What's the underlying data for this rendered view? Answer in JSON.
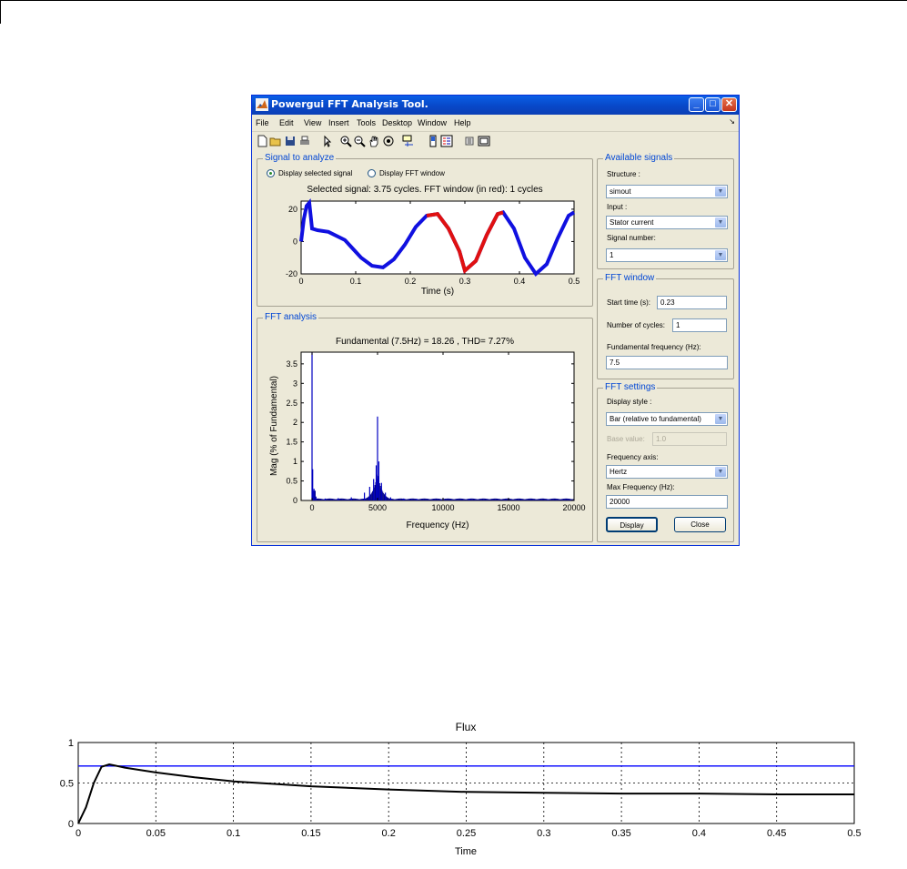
{
  "window": {
    "title": "Powergui FFT Analysis Tool.",
    "minimize_glyph": "_",
    "maximize_glyph": "□",
    "close_glyph": "✕"
  },
  "menu": [
    "File",
    "Edit",
    "View",
    "Insert",
    "Tools",
    "Desktop",
    "Window",
    "Help"
  ],
  "toolbar_icons": [
    "new-file-icon",
    "open-folder-icon",
    "save-icon",
    "print-icon",
    "pointer-icon",
    "zoom-in-icon",
    "zoom-out-icon",
    "pan-hand-icon",
    "rotate-icon",
    "data-cursor-icon",
    "colorbar-icon",
    "legend-icon",
    "hide-plot-tools-icon",
    "show-plot-tools-icon"
  ],
  "signal_panel": {
    "title": "Signal to analyze",
    "radio_selected": "Display selected signal",
    "radio_fft": "Display FFT window",
    "plot_title": "Selected signal: 3.75 cycles. FFT window (in red): 1 cycles",
    "xlabel": "Time (s)",
    "xticks": [
      "0",
      "0.1",
      "0.2",
      "0.3",
      "0.4",
      "0.5"
    ],
    "yticks": [
      "20",
      "0",
      "-20"
    ]
  },
  "fft_panel": {
    "title": "FFT analysis",
    "plot_title": "Fundamental (7.5Hz) = 18.26 , THD= 7.27%",
    "ylabel": "Mag (% of Fundamental)",
    "xlabel": "Frequency (Hz)",
    "xticks": [
      "0",
      "5000",
      "10000",
      "15000",
      "20000"
    ],
    "yticks": [
      "0",
      "0.5",
      "1",
      "1.5",
      "2",
      "2.5",
      "3",
      "3.5"
    ]
  },
  "available_signals": {
    "title": "Available signals",
    "structure_label": "Structure :",
    "structure_value": "simout",
    "input_label": "Input :",
    "input_value": "Stator current",
    "signal_number_label": "Signal number:",
    "signal_number_value": "1"
  },
  "fft_window": {
    "title": "FFT window",
    "start_time_label": "Start time (s):",
    "start_time_value": "0.23",
    "cycles_label": "Number of cycles:",
    "cycles_value": "1",
    "fund_freq_label": "Fundamental frequency (Hz):",
    "fund_freq_value": "7.5"
  },
  "fft_settings": {
    "title": "FFT settings",
    "display_style_label": "Display style :",
    "display_style_value": "Bar (relative to fundamental)",
    "base_value_label": "Base value:",
    "base_value_value": "1.0",
    "freq_axis_label": "Frequency axis:",
    "freq_axis_value": "Hertz",
    "max_freq_label": "Max Frequency (Hz):",
    "max_freq_value": "20000",
    "display_button": "Display",
    "close_button": "Close"
  },
  "colors": {
    "signal": "#1010e0",
    "fft_window": "#e01010",
    "fft_bars": "#00008b",
    "flux_reference": "#0000ff",
    "flux_curve": "#000000"
  },
  "chart_data": [
    {
      "type": "line",
      "title": "Selected signal: 3.75 cycles. FFT window (in red): 1 cycles",
      "xlabel": "Time (s)",
      "ylabel": "",
      "xlim": [
        0,
        0.5
      ],
      "ylim": [
        -20,
        25
      ],
      "xticks": [
        0,
        0.1,
        0.2,
        0.3,
        0.4,
        0.5
      ],
      "yticks": [
        -20,
        0,
        20
      ],
      "series": [
        {
          "x": [
            0,
            0.005,
            0.01,
            0.015,
            0.02,
            0.03,
            0.05,
            0.08,
            0.11,
            0.13,
            0.15,
            0.17,
            0.19,
            0.21,
            0.23,
            0.25,
            0.27,
            0.29,
            0.3,
            0.32,
            0.34,
            0.36,
            0.37,
            0.39,
            0.41,
            0.43,
            0.45,
            0.47,
            0.49,
            0.5
          ],
          "y": [
            0,
            14,
            22,
            24,
            8,
            7,
            6,
            1,
            -10,
            -15,
            -16,
            -11,
            -2,
            9,
            16,
            17,
            8,
            -6,
            -18,
            -12,
            4,
            17,
            18,
            8,
            -10,
            -20,
            -14,
            2,
            16,
            18
          ]
        }
      ],
      "fft_window_range": [
        0.23,
        0.3633
      ]
    },
    {
      "type": "bar",
      "title": "Fundamental (7.5Hz) = 18.26 , THD= 7.27%",
      "xlabel": "Frequency (Hz)",
      "ylabel": "Mag (% of Fundamental)",
      "xlim": [
        0,
        20000
      ],
      "ylim": [
        0,
        3.8
      ],
      "xticks": [
        0,
        5000,
        10000,
        15000,
        20000
      ],
      "yticks": [
        0,
        0.5,
        1,
        1.5,
        2,
        2.5,
        3,
        3.5
      ],
      "x": [
        0,
        50,
        150,
        300,
        1000,
        2000,
        3000,
        4000,
        4400,
        4700,
        4900,
        5000,
        5100,
        5300,
        5600,
        6000,
        7000,
        8000,
        10000,
        12000,
        15000,
        18000,
        20000
      ],
      "values": [
        3.8,
        0.8,
        0.3,
        0.1,
        0.05,
        0.06,
        0.08,
        0.2,
        0.35,
        0.55,
        0.9,
        2.15,
        1.0,
        0.45,
        0.2,
        0.08,
        0.05,
        0.04,
        0.05,
        0.04,
        0.03,
        0.03,
        0.02
      ]
    },
    {
      "type": "line",
      "title": "Flux",
      "xlabel": "Time",
      "ylabel": "",
      "xlim": [
        0,
        0.5
      ],
      "ylim": [
        0,
        1
      ],
      "xticks": [
        "0",
        "0.05",
        "0.1",
        "0.15",
        "0.2",
        "0.25",
        "0.3",
        "0.35",
        "0.4",
        "0.45",
        "0.5"
      ],
      "yticks": [
        "0",
        "0.5",
        "1"
      ],
      "grid": true,
      "series": [
        {
          "x": [
            0,
            0.005,
            0.01,
            0.015,
            0.02,
            0.025,
            0.03,
            0.05,
            0.075,
            0.1,
            0.125,
            0.15,
            0.2,
            0.25,
            0.3,
            0.35,
            0.4,
            0.45,
            0.5
          ],
          "y": [
            0,
            0.2,
            0.5,
            0.7,
            0.73,
            0.71,
            0.69,
            0.63,
            0.57,
            0.52,
            0.49,
            0.46,
            0.42,
            0.39,
            0.38,
            0.37,
            0.37,
            0.36,
            0.36
          ]
        },
        {
          "x": [
            0,
            0.5
          ],
          "y": [
            0.71,
            0.71
          ]
        }
      ]
    }
  ]
}
